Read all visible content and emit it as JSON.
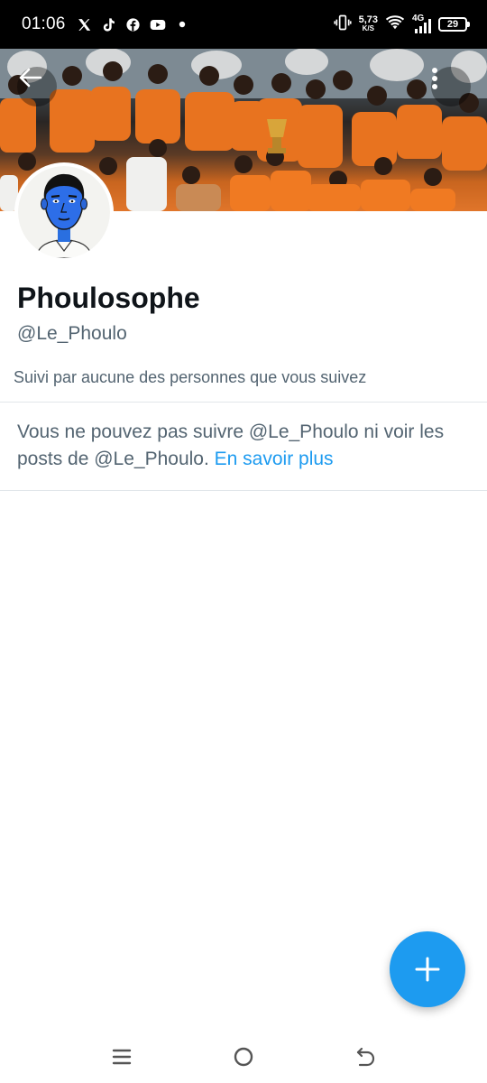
{
  "status_bar": {
    "time": "01:06",
    "left_icons": [
      "x-logo-icon",
      "tiktok-icon",
      "facebook-icon",
      "youtube-icon",
      "dot-icon"
    ],
    "net_speed_value": "5,73",
    "net_speed_unit": "K/S",
    "network_type": "4G",
    "battery_level": "29"
  },
  "profile": {
    "display_name": "Phoulosophe",
    "handle": "@Le_Phoulo",
    "followed_by_text": "Suivi par aucune des personnes que vous suivez"
  },
  "blocked_notice": {
    "message": "Vous ne pouvez pas suivre @Le_Phoulo ni voir les posts de @Le_Phoulo.",
    "link_text": "En savoir plus"
  },
  "colors": {
    "accent": "#1d9bf0",
    "text_primary": "#0f1419",
    "text_secondary": "#536471",
    "divider": "#e1e6ea"
  },
  "nav_bar": {
    "icons": [
      "menu-icon",
      "home-circle-icon",
      "back-icon"
    ]
  }
}
